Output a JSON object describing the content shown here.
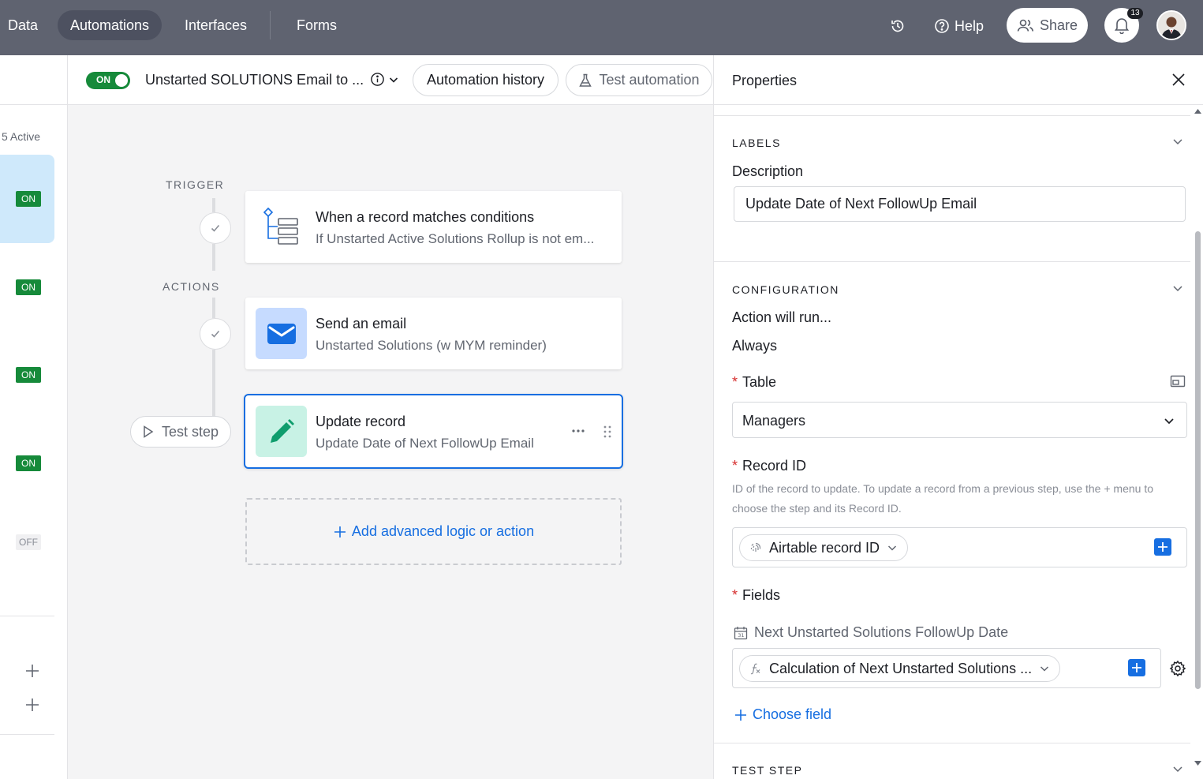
{
  "topnav": {
    "items": [
      {
        "label": "Data",
        "active": false
      },
      {
        "label": "Automations",
        "active": true
      },
      {
        "label": "Interfaces",
        "active": false
      },
      {
        "label": "Forms",
        "active": false
      }
    ],
    "help_label": "Help",
    "share_label": "Share",
    "notification_count": "13"
  },
  "sidebar": {
    "active_count": "5 Active",
    "rows": [
      {
        "status": "ON",
        "selected": true
      },
      {
        "status": "ON",
        "selected": false
      },
      {
        "status": "ON",
        "selected": false
      },
      {
        "status": "ON",
        "selected": false
      },
      {
        "status": "OFF",
        "selected": false
      }
    ]
  },
  "automation": {
    "toggle_label": "ON",
    "title": "Unstarted SOLUTIONS Email to ...",
    "history_label": "Automation history",
    "test_label": "Test automation"
  },
  "canvas": {
    "trigger_label": "TRIGGER",
    "actions_label": "ACTIONS",
    "trigger_card": {
      "title": "When a record matches conditions",
      "subtitle": "If Unstarted Active Solutions Rollup is not em..."
    },
    "email_card": {
      "title": "Send an email",
      "subtitle": "Unstarted Solutions (w MYM reminder)"
    },
    "update_card": {
      "title": "Update record",
      "subtitle": "Update Date of Next FollowUp Email"
    },
    "test_step_label": "Test step",
    "add_label": "Add advanced logic or action"
  },
  "properties": {
    "title": "Properties",
    "labels_section": "LABELS",
    "description_label": "Description",
    "description_value": "Update Date of Next FollowUp Email",
    "configuration_section": "CONFIGURATION",
    "run_label": "Action will run...",
    "run_value": "Always",
    "table_label": "Table",
    "table_value": "Managers",
    "record_id_label": "Record ID",
    "record_id_help": "ID of the record to update. To update a record from a previous step, use the + menu to choose the step and its Record ID.",
    "record_id_token": "Airtable record ID",
    "fields_label": "Fields",
    "field_name": "Next Unstarted Solutions FollowUp Date",
    "field_token": "Calculation of Next Unstarted Solutions ...",
    "choose_field_label": "Choose field",
    "test_step_section": "TEST STEP"
  },
  "colors": {
    "topbar": "#5f6370",
    "on_green": "#168a3a",
    "accent_blue": "#166ee1",
    "selected_row": "#cfe9fb"
  }
}
